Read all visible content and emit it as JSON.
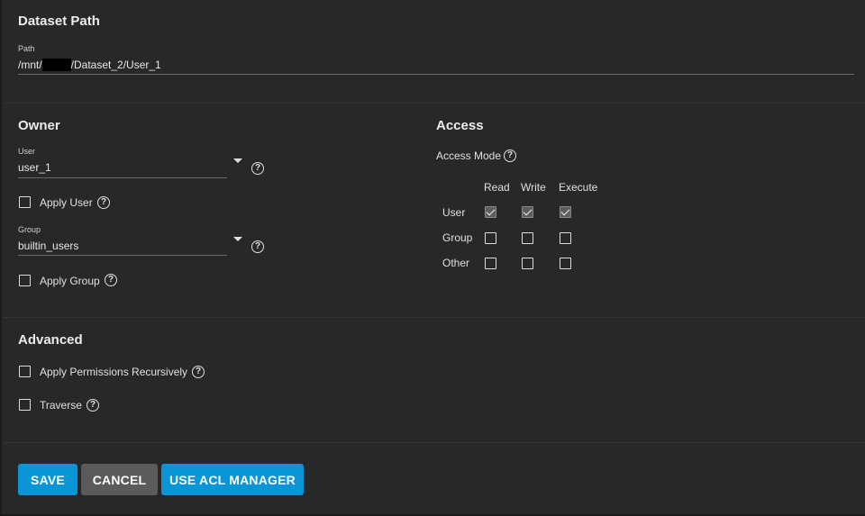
{
  "dataset_path": {
    "title": "Dataset Path",
    "path_label": "Path",
    "path_prefix": "/mnt/",
    "path_suffix": "/Dataset_2/User_1"
  },
  "owner": {
    "title": "Owner",
    "user_label": "User",
    "user_value": "user_1",
    "apply_user_label": "Apply User",
    "group_label": "Group",
    "group_value": "builtin_users",
    "apply_group_label": "Apply Group"
  },
  "access": {
    "title": "Access",
    "mode_label": "Access Mode",
    "columns": [
      "Read",
      "Write",
      "Execute"
    ],
    "rows": [
      {
        "label": "User",
        "values": [
          true,
          true,
          true
        ]
      },
      {
        "label": "Group",
        "values": [
          false,
          false,
          false
        ]
      },
      {
        "label": "Other",
        "values": [
          false,
          false,
          false
        ]
      }
    ]
  },
  "advanced": {
    "title": "Advanced",
    "recursive_label": "Apply Permissions Recursively",
    "traverse_label": "Traverse"
  },
  "actions": {
    "save": "SAVE",
    "cancel": "CANCEL",
    "acl": "USE ACL MANAGER"
  },
  "colors": {
    "primary": "#0a95d6",
    "secondary": "#5b5b5b",
    "background": "#282828"
  }
}
